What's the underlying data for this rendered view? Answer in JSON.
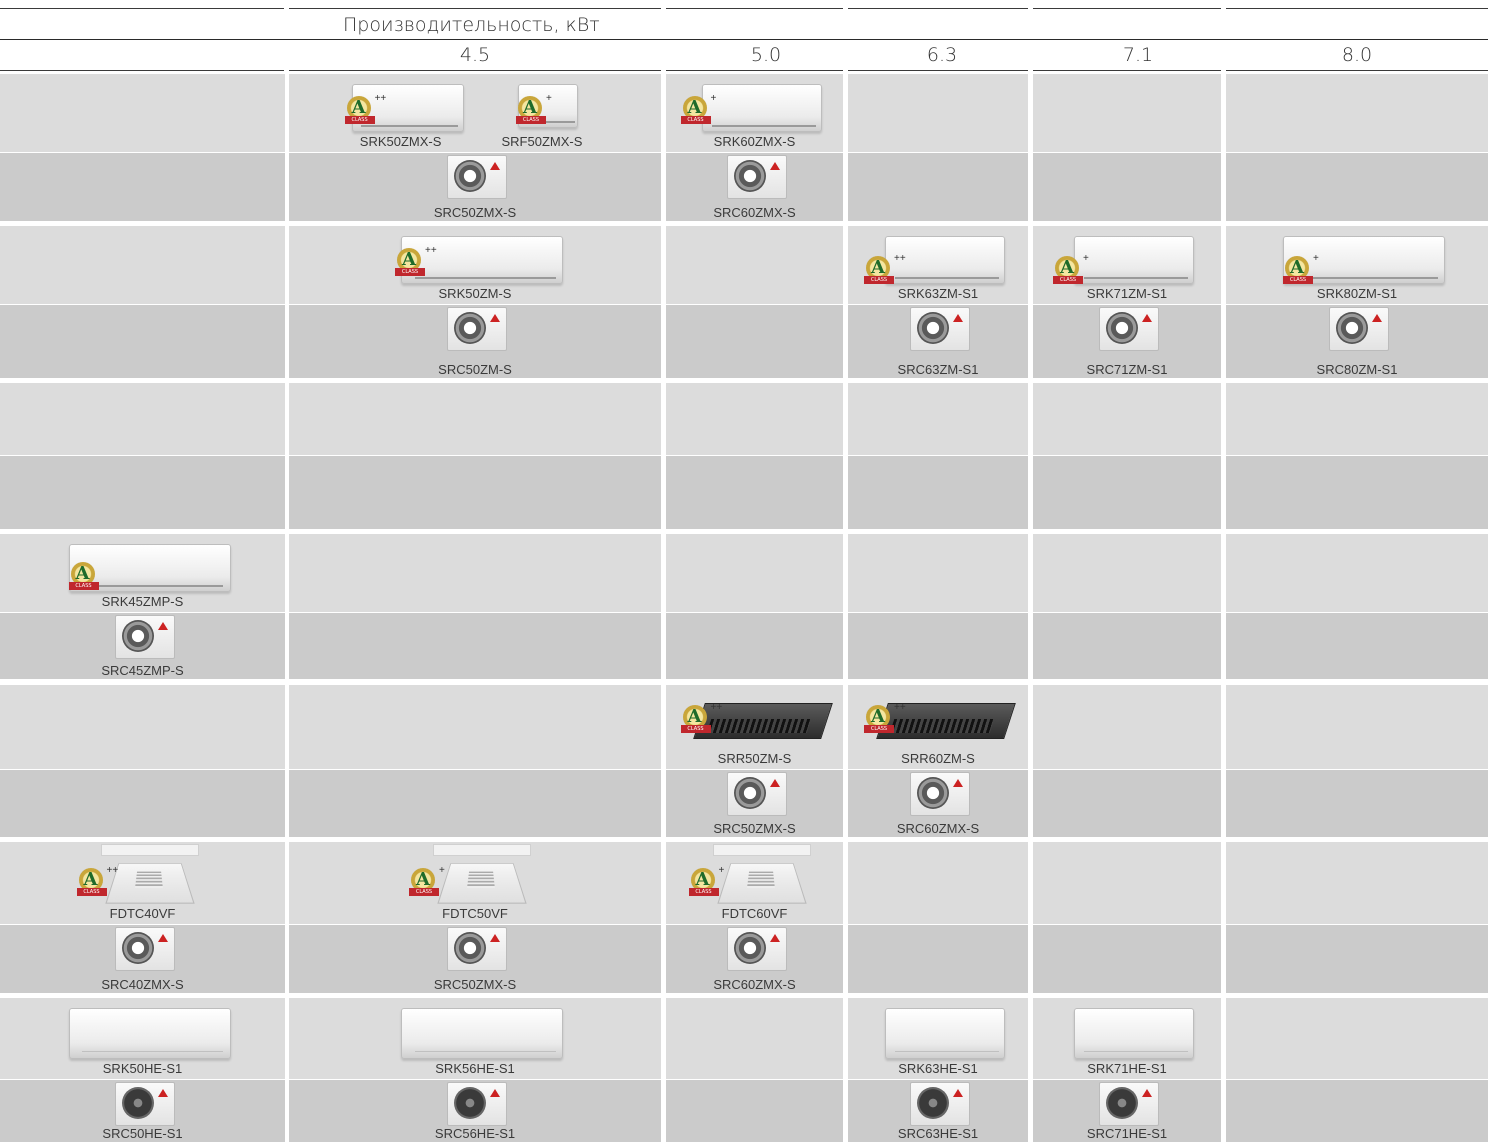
{
  "header": {
    "title": "Производительность, кВт",
    "capacities": [
      "4.5",
      "5.0",
      "6.3",
      "7.1",
      "8.0"
    ]
  },
  "badge": {
    "letter": "A",
    "ribbon": "CLASS"
  },
  "groups": [
    {
      "indoor": {
        "col0": [],
        "col1": [
          {
            "model": "SRK50ZMX-S",
            "type": "wall",
            "rating": "++"
          },
          {
            "model": "SRF50ZMX-S",
            "type": "floor",
            "rating": "+"
          }
        ],
        "col2": [
          {
            "model": "SRK60ZMX-S",
            "type": "wall",
            "rating": "+"
          }
        ],
        "col3": [],
        "col4": [],
        "col5": []
      },
      "outdoor": {
        "col1": "SRC50ZMX-S",
        "col2": "SRC60ZMX-S"
      }
    },
    {
      "indoor": {
        "col1": [
          {
            "model": "SRK50ZM-S",
            "type": "wall",
            "rating": "++"
          }
        ],
        "col3": [
          {
            "model": "SRK63ZM-S1",
            "type": "wall",
            "rating": "++"
          }
        ],
        "col4": [
          {
            "model": "SRK71ZM-S1",
            "type": "wall",
            "rating": "+"
          }
        ],
        "col5": [
          {
            "model": "SRK80ZM-S1",
            "type": "wall",
            "rating": "+"
          }
        ]
      },
      "outdoor": {
        "col1": "SRC50ZM-S",
        "col3": "SRC63ZM-S1",
        "col4": "SRC71ZM-S1",
        "col5": "SRC80ZM-S1"
      }
    },
    {
      "indoor": {},
      "outdoor": {}
    },
    {
      "indoor": {
        "col0": [
          {
            "model": "SRK45ZMP-S",
            "type": "wall",
            "rating": ""
          }
        ]
      },
      "outdoor": {
        "col0": "SRC45ZMP-S"
      }
    },
    {
      "indoor": {
        "col2": [
          {
            "model": "SRR50ZM-S",
            "type": "duct",
            "rating": "++"
          }
        ],
        "col3": [
          {
            "model": "SRR60ZM-S",
            "type": "duct",
            "rating": "++"
          }
        ]
      },
      "outdoor": {
        "col2": "SRC50ZMX-S",
        "col3": "SRC60ZMX-S"
      }
    },
    {
      "indoor": {
        "col0": [
          {
            "model": "FDTC40VF",
            "type": "cassette",
            "rating": "++"
          }
        ],
        "col1": [
          {
            "model": "FDTC50VF",
            "type": "cassette",
            "rating": "+"
          }
        ],
        "col2": [
          {
            "model": "FDTC60VF",
            "type": "cassette",
            "rating": "+"
          }
        ]
      },
      "outdoor": {
        "col0": "SRC40ZMX-S",
        "col1": "SRC50ZMX-S",
        "col2": "SRC60ZMX-S"
      }
    },
    {
      "indoor": {
        "col0": [
          {
            "model": "SRK50HE-S1",
            "type": "wall-plain",
            "rating": ""
          }
        ],
        "col1": [
          {
            "model": "SRK56HE-S1",
            "type": "wall-plain",
            "rating": ""
          }
        ],
        "col3": [
          {
            "model": "SRK63HE-S1",
            "type": "wall-plain",
            "rating": ""
          }
        ],
        "col4": [
          {
            "model": "SRK71HE-S1",
            "type": "wall-plain",
            "rating": ""
          }
        ]
      },
      "outdoor": {
        "col0": "SRC50HE-S1",
        "col1": "SRC56HE-S1",
        "col3": "SRC63HE-S1",
        "col4": "SRC71HE-S1"
      }
    }
  ]
}
